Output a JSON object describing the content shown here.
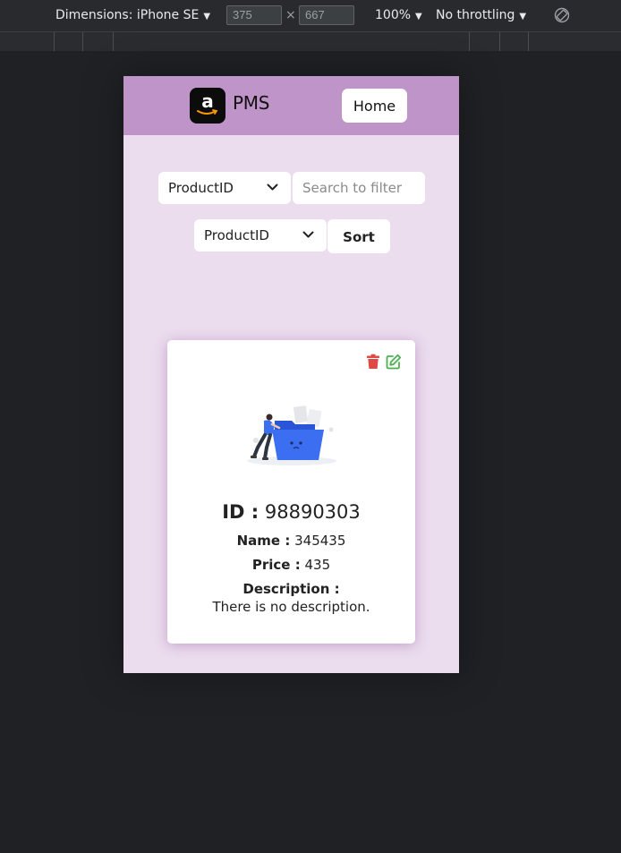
{
  "devtools": {
    "dimensions_label": "Dimensions: iPhone SE",
    "width_value": "375",
    "times": "×",
    "height_value": "667",
    "zoom": "100%",
    "throttling": "No throttling",
    "dropdown_arrow": "▼"
  },
  "navbar": {
    "logo_letter": "a",
    "brand": "PMS",
    "home_label": "Home"
  },
  "filters": {
    "filter_select_value": "ProductID",
    "search_placeholder": "Search to filter",
    "sort_select_value": "ProductID",
    "sort_label": "Sort"
  },
  "product": {
    "id_label": "ID :",
    "id_value": "98890303",
    "name_label": "Name :",
    "name_value": "345435",
    "price_label": "Price :",
    "price_value": "435",
    "description_label": "Description :",
    "description_value": "There is no description."
  },
  "colors": {
    "navbar": "#bf94c9",
    "page_bg": "#ebdcee",
    "delete_icon": "#dc4b45",
    "edit_icon": "#4caf50",
    "folder": "#3b6ef0"
  }
}
